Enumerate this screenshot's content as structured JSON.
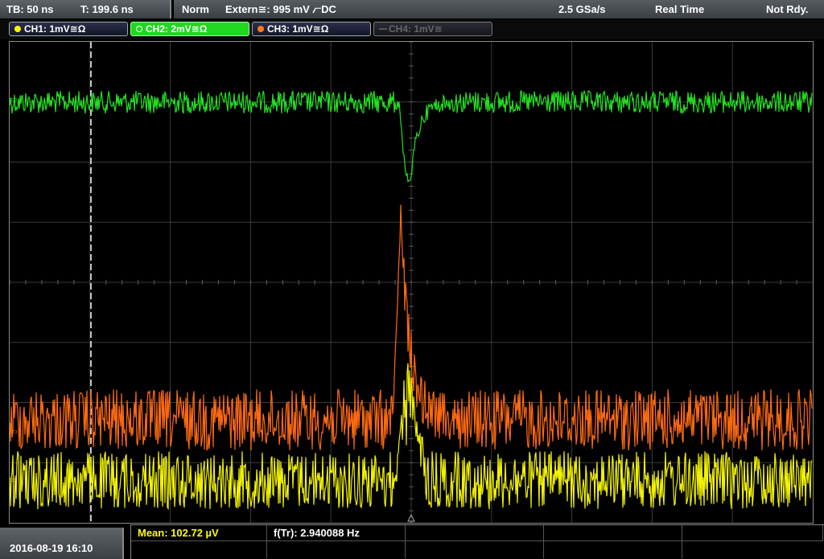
{
  "header": {
    "timebase": "TB: 50 ns",
    "trigger_time": "T: 199.6 ns",
    "trigger_mode": "Norm",
    "trigger_source": "Extern≅: 995 mV ⦧DC",
    "sample_rate": "2.5 GSa/s",
    "acq_mode": "Real Time",
    "status": "Not Rdy."
  },
  "channels": [
    {
      "label": "CH1: 1mV≅Ω",
      "color": "#ffff00",
      "state": "on"
    },
    {
      "label": "CH2: 2mV≅Ω",
      "color": "#33ff33",
      "state": "active"
    },
    {
      "label": "CH3: 1mV≅Ω",
      "color": "#ff7a1a",
      "state": "on"
    },
    {
      "label": "CH4: 1mV≅",
      "color": "#888888",
      "state": "off"
    }
  ],
  "trace_colors": {
    "ch1": "#f2f200",
    "ch2": "#22e022",
    "ch3": "#ff6a10",
    "grid": "#3a3a3a"
  },
  "footer": {
    "datetime": "2016-08-19 16:10",
    "measurements": [
      {
        "label": "Mean: 102.72 µV",
        "color": "#ffff00"
      },
      {
        "label": "f(Tr): 2.940088 Hz",
        "color": "#ffffff"
      }
    ]
  }
}
